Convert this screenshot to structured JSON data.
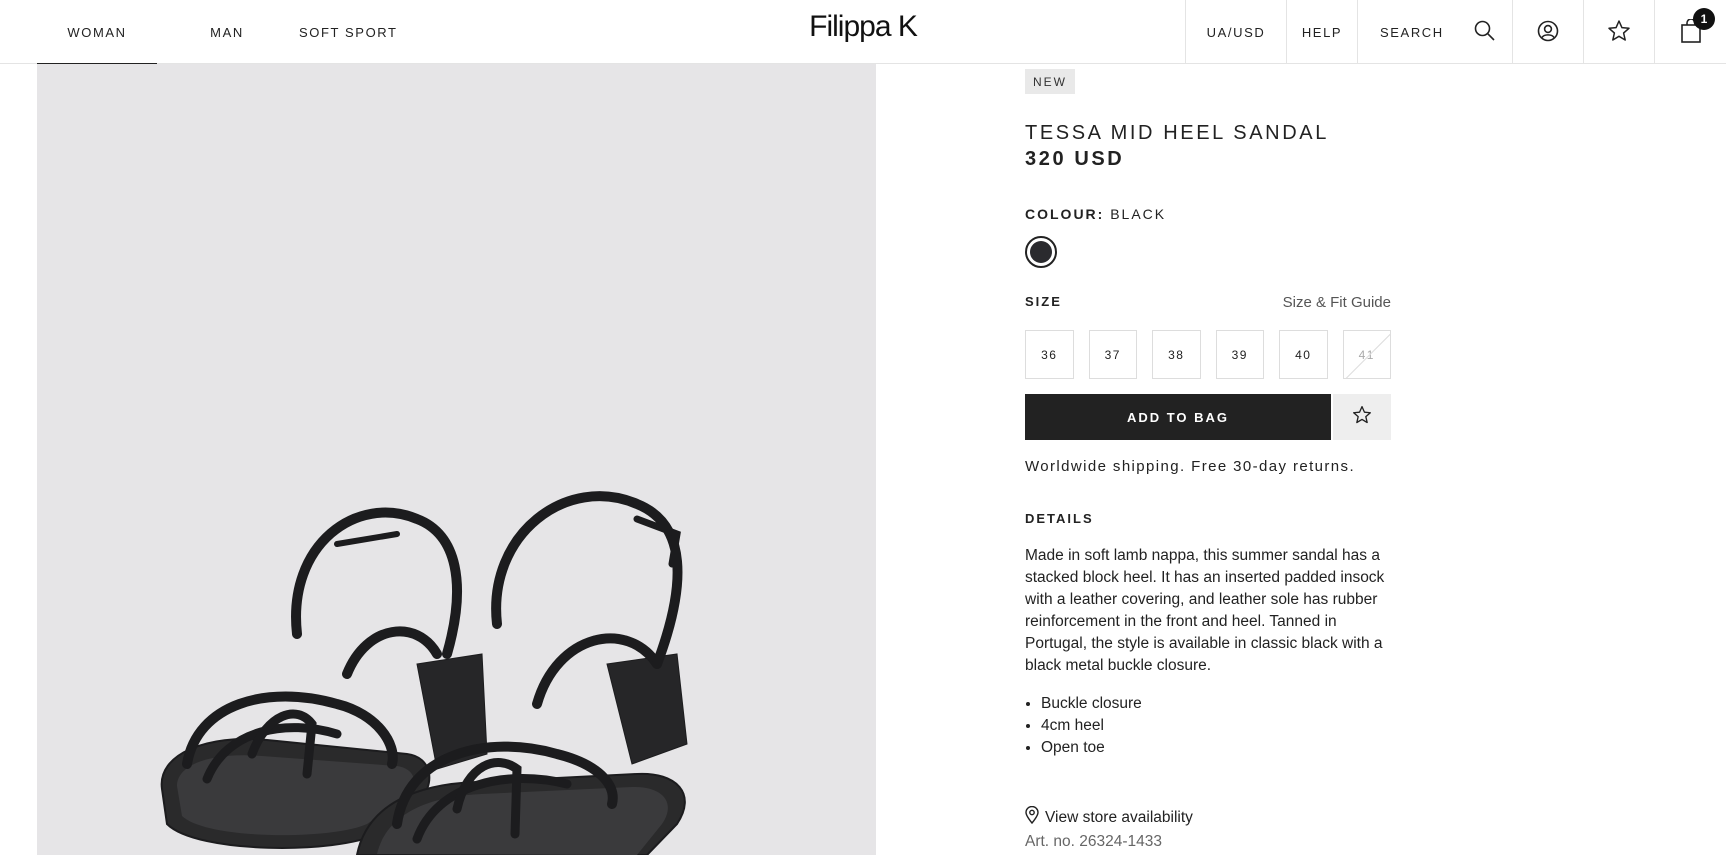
{
  "header": {
    "nav_left": [
      "WOMAN",
      "MAN",
      "SOFT SPORT"
    ],
    "logo": "Filippa K",
    "region": "UA/USD",
    "help": "HELP",
    "search": "SEARCH",
    "bag_count": "1",
    "icons": [
      "search-icon",
      "account-icon",
      "star-icon",
      "bag-icon"
    ]
  },
  "product": {
    "badge": "NEW",
    "title": "TESSA MID HEEL SANDAL",
    "price": "320 USD",
    "colour_label": "COLOUR:",
    "colour_value": "BLACK",
    "swatch_color": "#2a2a2e",
    "size_label": "SIZE",
    "fit_guide": "Size & Fit Guide",
    "sizes": [
      "36",
      "37",
      "38",
      "39",
      "40",
      "41"
    ],
    "sizes_unavailable": [
      "41"
    ],
    "add_to_bag": "ADD TO BAG",
    "shipping": "Worldwide shipping. Free 30-day returns.",
    "details_label": "DETAILS",
    "description": "Made in soft lamb nappa, this summer sandal has a stacked block heel. It has an inserted padded insock with a leather covering, and leather sole has rubber reinforcement in the front and heel. Tanned in Portugal, the style is available in classic black with a black metal buckle closure.",
    "features": [
      "Buckle closure",
      "4cm heel",
      "Open toe"
    ],
    "store_availability": "View store availability",
    "article_no": "Art. no. 26324-1433"
  }
}
